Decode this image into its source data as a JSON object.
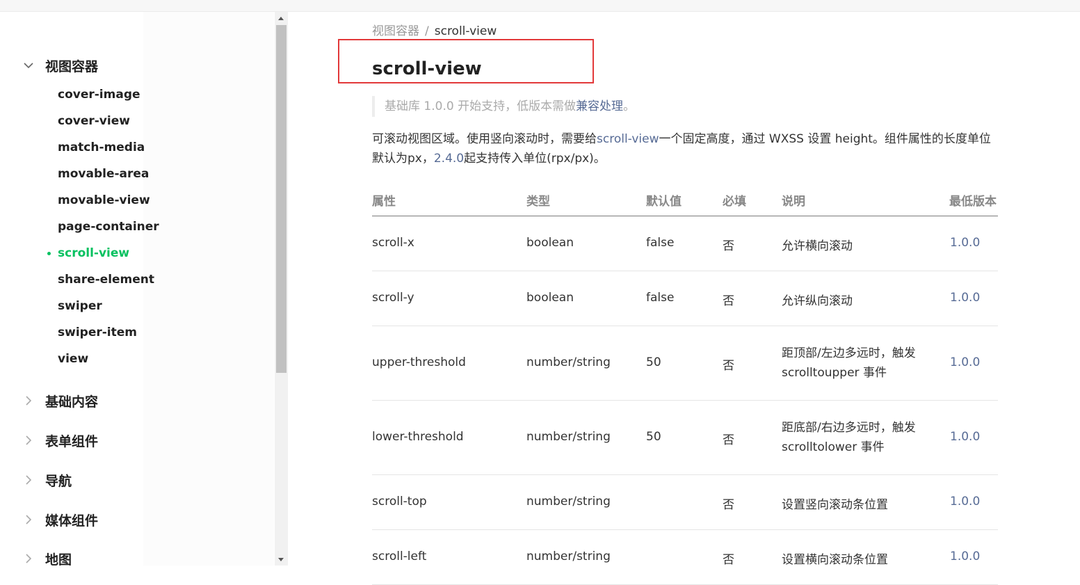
{
  "sidebar": {
    "groups": [
      {
        "label": "视图容器",
        "expanded": true
      },
      {
        "label": "基础内容"
      },
      {
        "label": "表单组件"
      },
      {
        "label": "导航"
      },
      {
        "label": "媒体组件"
      },
      {
        "label": "地图"
      }
    ],
    "items": [
      "cover-image",
      "cover-view",
      "match-media",
      "movable-area",
      "movable-view",
      "page-container",
      "scroll-view",
      "share-element",
      "swiper",
      "swiper-item",
      "view"
    ],
    "active_item": "scroll-view",
    "active_color": "#07c160"
  },
  "breadcrumb": {
    "parent": "视图容器",
    "separator": "/",
    "current": "scroll-view"
  },
  "page_title": "scroll-view",
  "note": {
    "prefix": "基础库 1.0.0 开始支持，低版本需做",
    "link": "兼容处理",
    "suffix": "。"
  },
  "description": {
    "part1": "可滚动视图区域。使用竖向滚动时，需要给",
    "link1": "scroll-view",
    "part2": "一个固定高度，通过 WXSS 设置 height。组件属性的长度单位默认为px，",
    "link2": "2.4.0",
    "part3": "起支持传入单位(rpx/px)。"
  },
  "table": {
    "headers": [
      "属性",
      "类型",
      "默认值",
      "必填",
      "说明",
      "最低版本"
    ],
    "rows": [
      [
        "scroll-x",
        "boolean",
        "false",
        "否",
        "允许横向滚动",
        "1.0.0"
      ],
      [
        "scroll-y",
        "boolean",
        "false",
        "否",
        "允许纵向滚动",
        "1.0.0"
      ],
      [
        "upper-threshold",
        "number/string",
        "50",
        "否",
        "距顶部/左边多远时，触发 scrolltoupper 事件",
        "1.0.0"
      ],
      [
        "lower-threshold",
        "number/string",
        "50",
        "否",
        "距底部/右边多远时，触发 scrolltolower 事件",
        "1.0.0"
      ],
      [
        "scroll-top",
        "number/string",
        "",
        "否",
        "设置竖向滚动条位置",
        "1.0.0"
      ],
      [
        "scroll-left",
        "number/string",
        "",
        "否",
        "设置横向滚动条位置",
        "1.0.0"
      ]
    ]
  },
  "colors": {
    "link": "#576b95",
    "highlight_border": "#e2393a"
  },
  "icons": {
    "expanded": "chevron-down-icon",
    "collapsed": "chevron-right-icon"
  }
}
